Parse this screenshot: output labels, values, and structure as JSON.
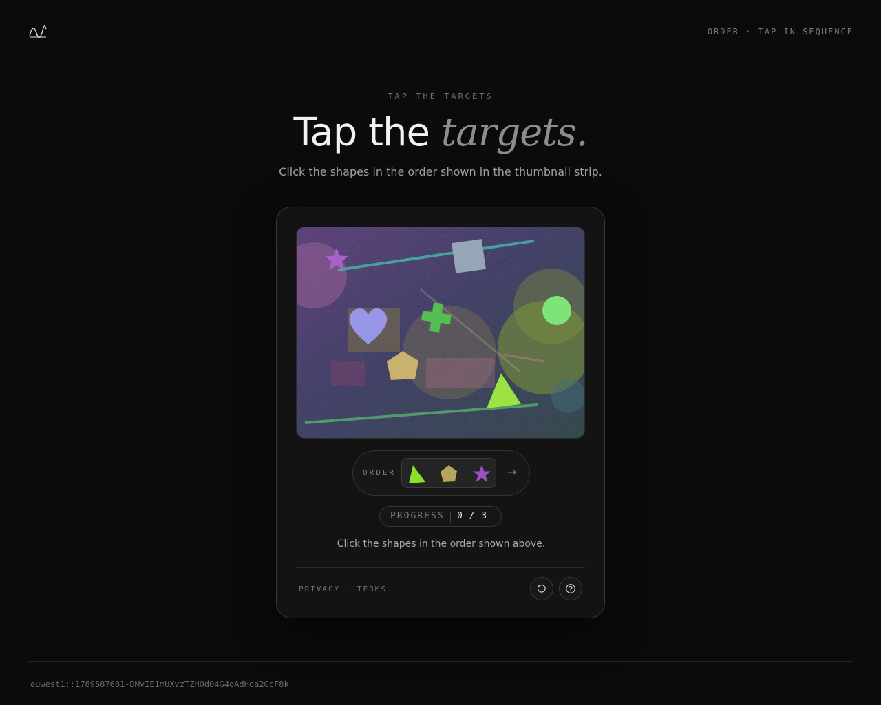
{
  "header": {
    "logo": "wave-logo-icon",
    "tag": "ORDER · TAP IN SEQUENCE"
  },
  "hero": {
    "eyebrow": "TAP THE TARGETS",
    "title_main": "Tap the ",
    "title_accent": "targets.",
    "subtitle": "Click the shapes in the order shown in the thumbnail strip."
  },
  "challenge": {
    "canvas": {
      "shapes": [
        "star",
        "square",
        "heart",
        "cross",
        "circle",
        "pentagon",
        "triangle"
      ]
    },
    "order": {
      "label": "ORDER",
      "thumbnails": [
        {
          "shape": "triangle",
          "color": "#8ee02a"
        },
        {
          "shape": "pentagon",
          "color": "#b5a45e"
        },
        {
          "shape": "star",
          "color": "#9a4fc4"
        }
      ],
      "next_icon": "→"
    },
    "progress": {
      "label": "PROGRESS",
      "value": "0 / 3"
    },
    "instruction": "Click the shapes in the order shown above.",
    "footer": {
      "privacy": "PRIVACY",
      "separator": "·",
      "terms": "TERMS",
      "buttons": [
        "refresh-icon",
        "help-icon"
      ]
    }
  },
  "footer": {
    "session_id": "euwest1::1789587681-DMvIE1mUXvzTZHOd04G4oAdHoa2GcF8k"
  },
  "colors": {
    "background": "#0b0b0b",
    "card_border": "#3a3a3a",
    "accent_green": "#8ee02a",
    "accent_purple": "#9a4fc4"
  }
}
